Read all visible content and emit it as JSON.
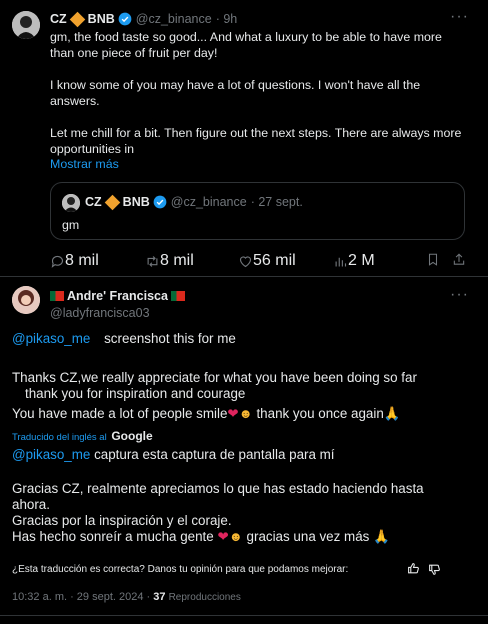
{
  "tweet": {
    "author_name": "CZ",
    "author_suffix": "BNB",
    "handle": "@cz_binance",
    "time": "· 9h",
    "text_lines": [
      "gm, the food taste so good... And what a luxury to be able to have more",
      "than one piece of fruit per day!",
      "",
      "I know some of you may have a lot of questions. I won't have all the",
      "answers.",
      "",
      "Let me chill for a bit. Then figure out the next steps. There are always more",
      "opportunities in"
    ],
    "show_more": "Mostrar más",
    "quote": {
      "author_name": "CZ",
      "author_suffix": "BNB",
      "handle": "@cz_binance",
      "time": "· 27 sept.",
      "text": "gm"
    },
    "actions": {
      "replies": "8 mil",
      "retweets": "8 mil",
      "likes": "56 mil",
      "views": "2 M"
    }
  },
  "reply": {
    "author_name": "Andre' Francisca",
    "handle": "@ladyfrancisca03",
    "mention": "@pikaso_me",
    "line1": "screenshot this for me",
    "line2": "Thanks CZ,we really appreciate for what you have been doing so far",
    "line3": "thank you for inspiration and courage",
    "line4": "You have made a lot of people smile",
    "line4_end": "thank you once again",
    "translated_by": "Traducido del inglés al",
    "translated_brand": "Google",
    "es_mention": "@pikaso_me",
    "es_line1": "captura esta captura de pantalla para mí",
    "es_line2": "Gracias CZ, realmente apreciamos lo que has estado haciendo hasta",
    "es_line3": "ahora.",
    "es_line4": "Gracias por la inspiración y el coraje.",
    "es_line5": "Has hecho sonreír a mucha gente",
    "es_line5_end": "gracias una vez más",
    "feedback": "¿Esta traducción es correcta? Danos tu opinión para que podamos mejorar:",
    "timestamp": "10:32 a. m. · 29 sept. 2024 ·",
    "views_count": "37",
    "views_label": "Reproducciones"
  },
  "colors": {
    "accent": "#1d9bf0",
    "background": "#000000",
    "text": "#e7e9ea",
    "muted": "#71767b"
  }
}
